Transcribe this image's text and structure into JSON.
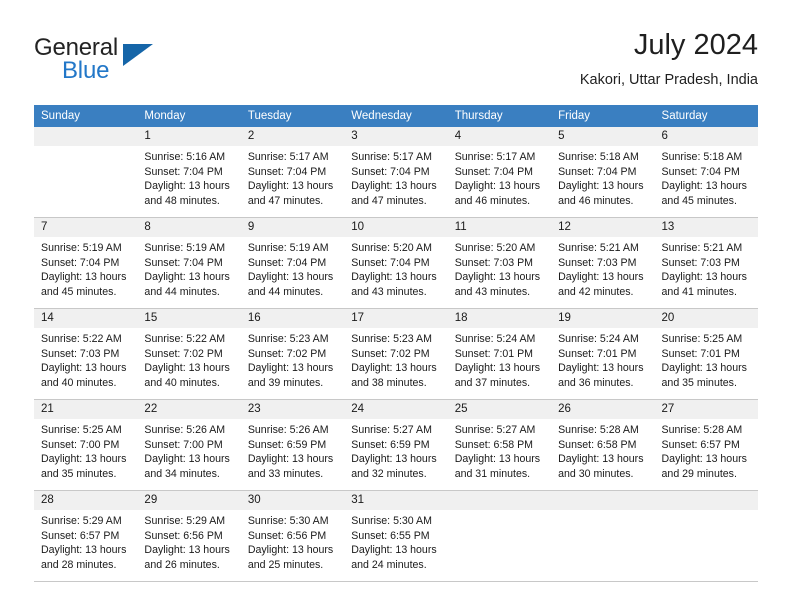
{
  "brand": {
    "name_part1": "General",
    "name_part2": "Blue",
    "logo_icon": "triangle-logo-icon"
  },
  "header": {
    "title": "July 2024",
    "subtitle": "Kakori, Uttar Pradesh, India"
  },
  "calendar": {
    "weekday_headers": [
      "Sunday",
      "Monday",
      "Tuesday",
      "Wednesday",
      "Thursday",
      "Friday",
      "Saturday"
    ],
    "accent_color": "#3a7fc1",
    "daynum_bg": "#f0f0f0",
    "grid_line_color": "#c8c8c8",
    "weeks": [
      [
        {
          "day": "",
          "sunrise": "",
          "sunset": "",
          "daylight_line1": "",
          "daylight_line2": ""
        },
        {
          "day": "1",
          "sunrise": "Sunrise: 5:16 AM",
          "sunset": "Sunset: 7:04 PM",
          "daylight_line1": "Daylight: 13 hours",
          "daylight_line2": "and 48 minutes."
        },
        {
          "day": "2",
          "sunrise": "Sunrise: 5:17 AM",
          "sunset": "Sunset: 7:04 PM",
          "daylight_line1": "Daylight: 13 hours",
          "daylight_line2": "and 47 minutes."
        },
        {
          "day": "3",
          "sunrise": "Sunrise: 5:17 AM",
          "sunset": "Sunset: 7:04 PM",
          "daylight_line1": "Daylight: 13 hours",
          "daylight_line2": "and 47 minutes."
        },
        {
          "day": "4",
          "sunrise": "Sunrise: 5:17 AM",
          "sunset": "Sunset: 7:04 PM",
          "daylight_line1": "Daylight: 13 hours",
          "daylight_line2": "and 46 minutes."
        },
        {
          "day": "5",
          "sunrise": "Sunrise: 5:18 AM",
          "sunset": "Sunset: 7:04 PM",
          "daylight_line1": "Daylight: 13 hours",
          "daylight_line2": "and 46 minutes."
        },
        {
          "day": "6",
          "sunrise": "Sunrise: 5:18 AM",
          "sunset": "Sunset: 7:04 PM",
          "daylight_line1": "Daylight: 13 hours",
          "daylight_line2": "and 45 minutes."
        }
      ],
      [
        {
          "day": "7",
          "sunrise": "Sunrise: 5:19 AM",
          "sunset": "Sunset: 7:04 PM",
          "daylight_line1": "Daylight: 13 hours",
          "daylight_line2": "and 45 minutes."
        },
        {
          "day": "8",
          "sunrise": "Sunrise: 5:19 AM",
          "sunset": "Sunset: 7:04 PM",
          "daylight_line1": "Daylight: 13 hours",
          "daylight_line2": "and 44 minutes."
        },
        {
          "day": "9",
          "sunrise": "Sunrise: 5:19 AM",
          "sunset": "Sunset: 7:04 PM",
          "daylight_line1": "Daylight: 13 hours",
          "daylight_line2": "and 44 minutes."
        },
        {
          "day": "10",
          "sunrise": "Sunrise: 5:20 AM",
          "sunset": "Sunset: 7:04 PM",
          "daylight_line1": "Daylight: 13 hours",
          "daylight_line2": "and 43 minutes."
        },
        {
          "day": "11",
          "sunrise": "Sunrise: 5:20 AM",
          "sunset": "Sunset: 7:03 PM",
          "daylight_line1": "Daylight: 13 hours",
          "daylight_line2": "and 43 minutes."
        },
        {
          "day": "12",
          "sunrise": "Sunrise: 5:21 AM",
          "sunset": "Sunset: 7:03 PM",
          "daylight_line1": "Daylight: 13 hours",
          "daylight_line2": "and 42 minutes."
        },
        {
          "day": "13",
          "sunrise": "Sunrise: 5:21 AM",
          "sunset": "Sunset: 7:03 PM",
          "daylight_line1": "Daylight: 13 hours",
          "daylight_line2": "and 41 minutes."
        }
      ],
      [
        {
          "day": "14",
          "sunrise": "Sunrise: 5:22 AM",
          "sunset": "Sunset: 7:03 PM",
          "daylight_line1": "Daylight: 13 hours",
          "daylight_line2": "and 40 minutes."
        },
        {
          "day": "15",
          "sunrise": "Sunrise: 5:22 AM",
          "sunset": "Sunset: 7:02 PM",
          "daylight_line1": "Daylight: 13 hours",
          "daylight_line2": "and 40 minutes."
        },
        {
          "day": "16",
          "sunrise": "Sunrise: 5:23 AM",
          "sunset": "Sunset: 7:02 PM",
          "daylight_line1": "Daylight: 13 hours",
          "daylight_line2": "and 39 minutes."
        },
        {
          "day": "17",
          "sunrise": "Sunrise: 5:23 AM",
          "sunset": "Sunset: 7:02 PM",
          "daylight_line1": "Daylight: 13 hours",
          "daylight_line2": "and 38 minutes."
        },
        {
          "day": "18",
          "sunrise": "Sunrise: 5:24 AM",
          "sunset": "Sunset: 7:01 PM",
          "daylight_line1": "Daylight: 13 hours",
          "daylight_line2": "and 37 minutes."
        },
        {
          "day": "19",
          "sunrise": "Sunrise: 5:24 AM",
          "sunset": "Sunset: 7:01 PM",
          "daylight_line1": "Daylight: 13 hours",
          "daylight_line2": "and 36 minutes."
        },
        {
          "day": "20",
          "sunrise": "Sunrise: 5:25 AM",
          "sunset": "Sunset: 7:01 PM",
          "daylight_line1": "Daylight: 13 hours",
          "daylight_line2": "and 35 minutes."
        }
      ],
      [
        {
          "day": "21",
          "sunrise": "Sunrise: 5:25 AM",
          "sunset": "Sunset: 7:00 PM",
          "daylight_line1": "Daylight: 13 hours",
          "daylight_line2": "and 35 minutes."
        },
        {
          "day": "22",
          "sunrise": "Sunrise: 5:26 AM",
          "sunset": "Sunset: 7:00 PM",
          "daylight_line1": "Daylight: 13 hours",
          "daylight_line2": "and 34 minutes."
        },
        {
          "day": "23",
          "sunrise": "Sunrise: 5:26 AM",
          "sunset": "Sunset: 6:59 PM",
          "daylight_line1": "Daylight: 13 hours",
          "daylight_line2": "and 33 minutes."
        },
        {
          "day": "24",
          "sunrise": "Sunrise: 5:27 AM",
          "sunset": "Sunset: 6:59 PM",
          "daylight_line1": "Daylight: 13 hours",
          "daylight_line2": "and 32 minutes."
        },
        {
          "day": "25",
          "sunrise": "Sunrise: 5:27 AM",
          "sunset": "Sunset: 6:58 PM",
          "daylight_line1": "Daylight: 13 hours",
          "daylight_line2": "and 31 minutes."
        },
        {
          "day": "26",
          "sunrise": "Sunrise: 5:28 AM",
          "sunset": "Sunset: 6:58 PM",
          "daylight_line1": "Daylight: 13 hours",
          "daylight_line2": "and 30 minutes."
        },
        {
          "day": "27",
          "sunrise": "Sunrise: 5:28 AM",
          "sunset": "Sunset: 6:57 PM",
          "daylight_line1": "Daylight: 13 hours",
          "daylight_line2": "and 29 minutes."
        }
      ],
      [
        {
          "day": "28",
          "sunrise": "Sunrise: 5:29 AM",
          "sunset": "Sunset: 6:57 PM",
          "daylight_line1": "Daylight: 13 hours",
          "daylight_line2": "and 28 minutes."
        },
        {
          "day": "29",
          "sunrise": "Sunrise: 5:29 AM",
          "sunset": "Sunset: 6:56 PM",
          "daylight_line1": "Daylight: 13 hours",
          "daylight_line2": "and 26 minutes."
        },
        {
          "day": "30",
          "sunrise": "Sunrise: 5:30 AM",
          "sunset": "Sunset: 6:56 PM",
          "daylight_line1": "Daylight: 13 hours",
          "daylight_line2": "and 25 minutes."
        },
        {
          "day": "31",
          "sunrise": "Sunrise: 5:30 AM",
          "sunset": "Sunset: 6:55 PM",
          "daylight_line1": "Daylight: 13 hours",
          "daylight_line2": "and 24 minutes."
        },
        {
          "day": "",
          "sunrise": "",
          "sunset": "",
          "daylight_line1": "",
          "daylight_line2": ""
        },
        {
          "day": "",
          "sunrise": "",
          "sunset": "",
          "daylight_line1": "",
          "daylight_line2": ""
        },
        {
          "day": "",
          "sunrise": "",
          "sunset": "",
          "daylight_line1": "",
          "daylight_line2": ""
        }
      ]
    ]
  }
}
